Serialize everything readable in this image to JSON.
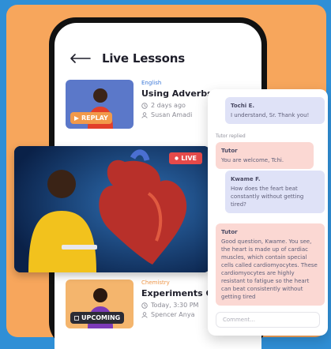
{
  "header": {
    "title": "Live Lessons"
  },
  "lessons": [
    {
      "subject": "English",
      "title": "Using Adverbs & Adjectives",
      "time": "2 days ago",
      "teacher": "Susan Amadi",
      "badge": "REPLAY"
    },
    {
      "subject": "Chemistry",
      "title": "Experiments On Acids And Bases",
      "time": "Today, 3:30 PM",
      "teacher": "Spencer Anya",
      "badge": "UPCOMING"
    }
  ],
  "video": {
    "badge": "LIVE"
  },
  "chat": {
    "messages": [
      {
        "sender": "Tochi E.",
        "text": "I understand, Sr. Thank you!",
        "kind": "student"
      },
      {
        "sender": "Tutor",
        "text": "You are welcome, Tchi.",
        "kind": "tutor"
      },
      {
        "sender": "Kwame F.",
        "text": "How does the feart beat constantly without getting tired?",
        "kind": "student"
      },
      {
        "sender": "Tutor",
        "text": "Good question, Kwame. You see, the heart is made up of cardiac muscles, which contain special cells called cardiomyocytes. These cardiomyocytes are highly resistant to fatigue so the heart can beat consistently without getting tired",
        "kind": "tutor"
      }
    ],
    "status": "Tutor replied",
    "comment_placeholder": "Comment..."
  },
  "colors": {
    "background_blue": "#2f8fd6",
    "panel_orange": "#f7a65c",
    "accent_blue": "#3d79d8",
    "accent_orange": "#f2994a",
    "live_red": "#e64a4a",
    "student_bubble": "#dfe2f7",
    "tutor_bubble": "#fbd8d3"
  }
}
